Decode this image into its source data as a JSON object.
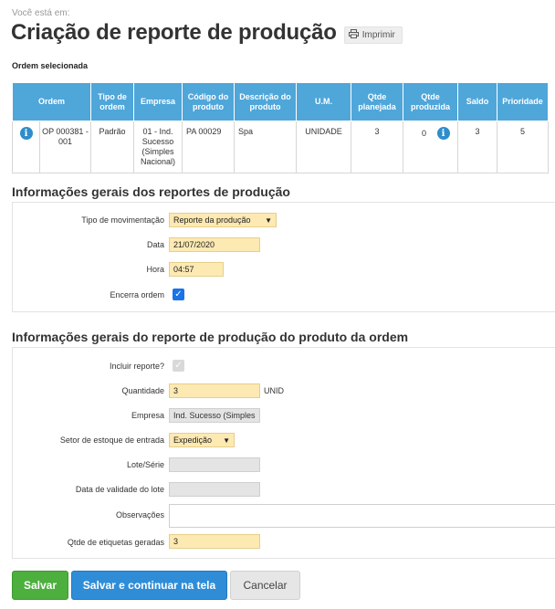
{
  "breadcrumb": "Você está em:",
  "page_title": "Criação de reporte de produção",
  "print_button": {
    "label": "Imprimir",
    "icon": "printer-icon"
  },
  "selected_order_label": "Ordem selecionada",
  "orders_table": {
    "headers": [
      "Ordem",
      "Tipo de ordem",
      "Empresa",
      "Código do produto",
      "Descrição do produto",
      "U.M.",
      "Qtde planejada",
      "Qtde produzida",
      "Saldo",
      "Prioridade"
    ],
    "row": {
      "ordem": "OP 000381 - 001",
      "tipo": "Padrão",
      "empresa": "01 - Ind. Sucesso (Simples Nacional)",
      "codigo": "PA 00029",
      "descricao": "Spa",
      "um": "UNIDADE",
      "qtde_planejada": "3",
      "qtde_produzida": "0",
      "saldo": "3",
      "prioridade": "5"
    }
  },
  "section1": {
    "title": "Informações gerais dos reportes de produção",
    "tipo_movimentacao": {
      "label": "Tipo de movimentação",
      "value": "Reporte da produção"
    },
    "data": {
      "label": "Data",
      "value": "21/07/2020"
    },
    "hora": {
      "label": "Hora",
      "value": "04:57"
    },
    "encerra_ordem": {
      "label": "Encerra ordem",
      "checked": true
    }
  },
  "section2": {
    "title": "Informações gerais do reporte de produção do produto da ordem",
    "incluir_reporte": {
      "label": "Incluir reporte?",
      "checked": true
    },
    "quantidade": {
      "label": "Quantidade",
      "value": "3",
      "unit": "UNID"
    },
    "empresa": {
      "label": "Empresa",
      "value": "Ind. Sucesso (Simples"
    },
    "setor_estoque": {
      "label": "Setor de estoque de entrada",
      "value": "Expedição"
    },
    "lote_serie": {
      "label": "Lote/Série",
      "value": ""
    },
    "data_validade": {
      "label": "Data de validade do lote",
      "value": ""
    },
    "observacoes": {
      "label": "Observações",
      "value": ""
    },
    "qtde_etiquetas": {
      "label": "Qtde de etiquetas geradas",
      "value": "3"
    }
  },
  "buttons": {
    "save": "Salvar",
    "save_continue": "Salvar e continuar na tela",
    "cancel": "Cancelar"
  },
  "colors": {
    "table_header": "#4fa6d9",
    "field_highlight": "#fde9b2",
    "save": "#4caf3e",
    "save_continue": "#2f8dd8"
  }
}
